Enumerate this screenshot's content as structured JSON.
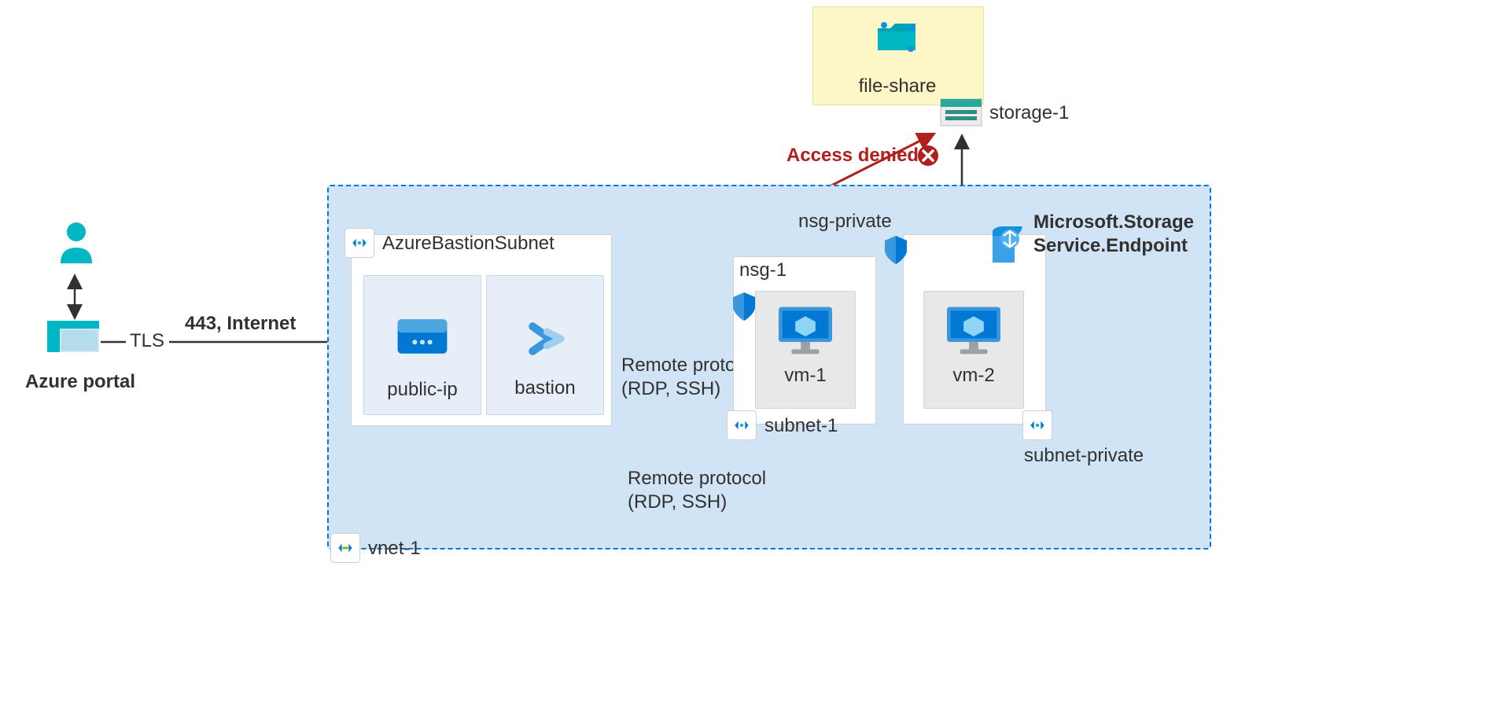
{
  "azure_portal_label": "Azure portal",
  "tls_label": "TLS",
  "internet_label": "443, Internet",
  "vnet_label": "vnet-1",
  "bastion_subnet_label": "AzureBastionSubnet",
  "public_ip_label": "public-ip",
  "bastion_label": "bastion",
  "remote_protocol_line1": "Remote protocol",
  "remote_protocol_line2": "(RDP, SSH)",
  "nsg1_label": "nsg-1",
  "vm1_label": "vm-1",
  "subnet1_label": "subnet-1",
  "nsg_private_label": "nsg-private",
  "vm2_label": "vm-2",
  "subnet_private_label": "subnet-private",
  "service_endpoint_line1": "Microsoft.Storage",
  "service_endpoint_line2": "Service.Endpoint",
  "storage1_label": "storage-1",
  "fileshare_label": "file-share",
  "access_denied_label": "Access denied",
  "colors": {
    "azure_blue": "#0078d4",
    "cyan": "#00b7c3",
    "red": "#b01e1e",
    "dark": "#323130"
  }
}
